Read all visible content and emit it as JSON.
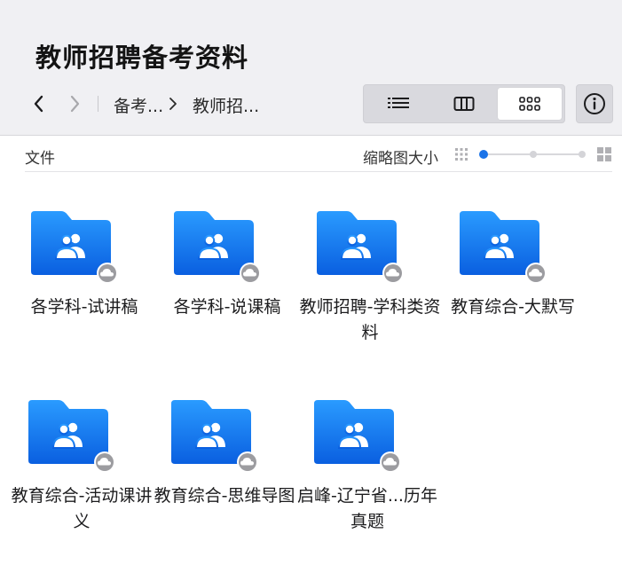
{
  "header": {
    "title": "教师招聘备考资料",
    "breadcrumb": [
      "备考...",
      "教师招..."
    ]
  },
  "toolbar": {
    "view_modes": [
      "list",
      "columns",
      "grid"
    ],
    "active_view": "grid"
  },
  "section": {
    "label": "文件",
    "thumbnail_size_label": "缩略图大小",
    "thumbnail_size_value": 0
  },
  "folders": [
    {
      "name": "各学科-试讲稿",
      "icon": "shared-folder-icon",
      "status": "cloud-icon"
    },
    {
      "name": "各学科-说课稿",
      "icon": "shared-folder-icon",
      "status": "cloud-icon"
    },
    {
      "name": "教师招聘-学科类资料",
      "icon": "shared-folder-icon",
      "status": "cloud-icon"
    },
    {
      "name": "教育综合-大默写",
      "icon": "shared-folder-icon",
      "status": "cloud-icon"
    },
    {
      "name": "教育综合-活动课讲义",
      "icon": "shared-folder-icon",
      "status": "cloud-icon"
    },
    {
      "name": "教育综合-思维导图",
      "icon": "shared-folder-icon",
      "status": "cloud-icon"
    },
    {
      "name": "启峰-辽宁省...历年真题",
      "icon": "shared-folder-icon",
      "status": "cloud-icon"
    }
  ],
  "colors": {
    "accent": "#1a73e8",
    "folder_top": "#2a9bff",
    "folder_bottom": "#0a5fe0",
    "header_bg": "#f0f0f3"
  }
}
